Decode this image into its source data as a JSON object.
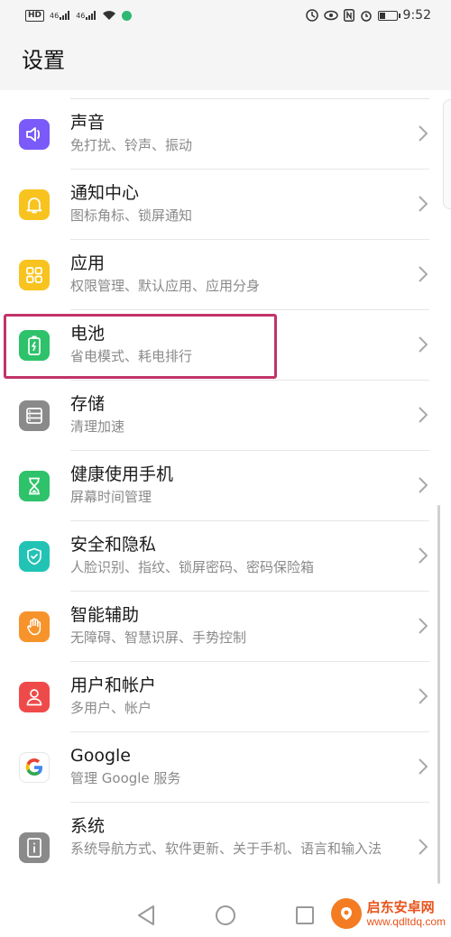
{
  "status_bar": {
    "hd": "HD",
    "signal1": "46",
    "signal2": "46",
    "time": "9:52"
  },
  "header": {
    "title": "设置"
  },
  "settings": [
    {
      "title": "声音",
      "subtitle": "免打扰、铃声、振动",
      "icon": "speaker-icon",
      "color": "#7a5af8"
    },
    {
      "title": "通知中心",
      "subtitle": "图标角标、锁屏通知",
      "icon": "bell-icon",
      "color": "#f8c31e"
    },
    {
      "title": "应用",
      "subtitle": "权限管理、默认应用、应用分身",
      "icon": "apps-grid-icon",
      "color": "#f8c31e"
    },
    {
      "title": "电池",
      "subtitle": "省电模式、耗电排行",
      "icon": "battery-icon",
      "color": "#2ec26a"
    },
    {
      "title": "存储",
      "subtitle": "清理加速",
      "icon": "storage-icon",
      "color": "#8a8a8a"
    },
    {
      "title": "健康使用手机",
      "subtitle": "屏幕时间管理",
      "icon": "hourglass-icon",
      "color": "#2ec26a"
    },
    {
      "title": "安全和隐私",
      "subtitle": "人脸识别、指纹、锁屏密码、密码保险箱",
      "icon": "shield-icon",
      "color": "#22c3b5"
    },
    {
      "title": "智能辅助",
      "subtitle": "无障碍、智慧识屏、手势控制",
      "icon": "hand-icon",
      "color": "#f7932b"
    },
    {
      "title": "用户和帐户",
      "subtitle": "多用户、帐户",
      "icon": "user-icon",
      "color": "#ef4a4a"
    },
    {
      "title": "Google",
      "subtitle": "管理 Google 服务",
      "icon": "google-icon",
      "color": "#ffffff"
    },
    {
      "title": "系统",
      "subtitle": "系统导航方式、软件更新、关于手机、语言和输入法",
      "icon": "system-info-icon",
      "color": "#8a8a8a"
    }
  ],
  "highlight_color": "#c2336a",
  "watermark": {
    "line1": "启东安卓网",
    "line2": "www.qdltdq.com"
  }
}
